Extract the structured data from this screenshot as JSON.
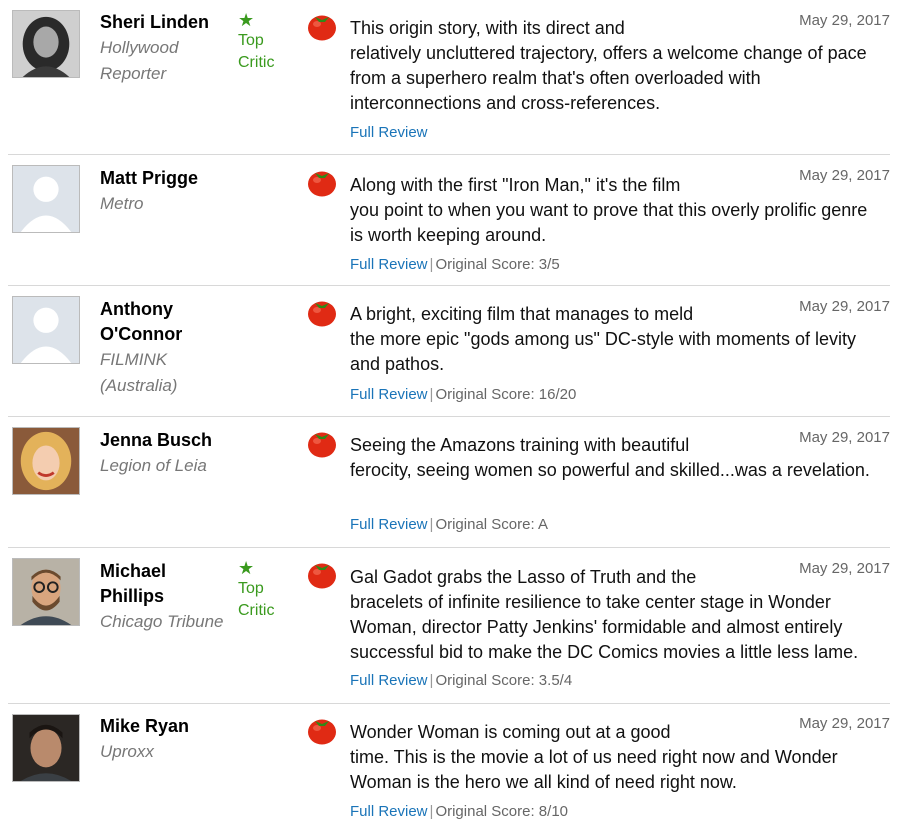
{
  "colors": {
    "link": "#1a74b8",
    "top_critic": "#3a9a1e",
    "date": "#666666",
    "publication": "#777777",
    "tomato": "#e02a14"
  },
  "reviews": [
    {
      "critic": "Sheri Linden",
      "publication": "Hollywood Reporter",
      "top_critic": true,
      "top_critic_label": "Top Critic",
      "star_icon": "star-icon",
      "date": "May 29, 2017",
      "quote_first": "This origin story, with its direct and",
      "quote_rest": "relatively uncluttered trajectory, offers a welcome change of pace from a superhero realm that's often overloaded with interconnections and cross-references.",
      "full_review": "Full Review",
      "original_score": "",
      "avatar_icon": "woman-dark-hair-photo"
    },
    {
      "critic": "Matt Prigge",
      "publication": "Metro",
      "top_critic": false,
      "date": "May 29, 2017",
      "quote_first": "Along with the first \"Iron Man,\" it's the film",
      "quote_rest": "you point to when you want to prove that this overly prolific genre is worth keeping around.",
      "full_review": "Full Review",
      "original_score": "Original Score: 3/5",
      "avatar_icon": "default-avatar-icon"
    },
    {
      "critic": "Anthony O'Connor",
      "publication": "FILMINK (Australia)",
      "top_critic": false,
      "date": "May 29, 2017",
      "quote_first": "A bright, exciting film that manages to meld",
      "quote_rest": "the more epic \"gods among us\" DC-style with moments of levity and pathos.",
      "full_review": "Full Review",
      "original_score": "Original Score: 16/20",
      "avatar_icon": "default-avatar-icon"
    },
    {
      "critic": "Jenna Busch",
      "publication": "Legion of Leia",
      "top_critic": false,
      "date": "May 29, 2017",
      "quote_first": "Seeing the Amazons training with beautiful",
      "quote_rest": "ferocity, seeing women so powerful and skilled...was a revelation.",
      "full_review": "Full Review",
      "original_score": "Original Score: A",
      "avatar_icon": "woman-blonde-photo"
    },
    {
      "critic": "Michael Phillips",
      "publication": "Chicago Tribune",
      "top_critic": true,
      "top_critic_label": "Top Critic",
      "star_icon": "star-icon",
      "date": "May 29, 2017",
      "quote_first": "Gal Gadot grabs the Lasso of Truth and the",
      "quote_rest": "bracelets of infinite resilience to take center stage in Wonder Woman, director Patty Jenkins' formidable and almost entirely successful bid to make the DC Comics movies a little less lame.",
      "full_review": "Full Review",
      "original_score": "Original Score: 3.5/4",
      "avatar_icon": "man-glasses-beard-photo"
    },
    {
      "critic": "Mike Ryan",
      "publication": "Uproxx",
      "top_critic": false,
      "date": "May 29, 2017",
      "quote_first": "Wonder Woman is coming out at a good",
      "quote_rest": "time. This is the movie a lot of us need right now and Wonder Woman is the hero we all kind of need right now.",
      "full_review": "Full Review",
      "original_score": "Original Score: 8/10",
      "avatar_icon": "man-dark-photo"
    }
  ]
}
